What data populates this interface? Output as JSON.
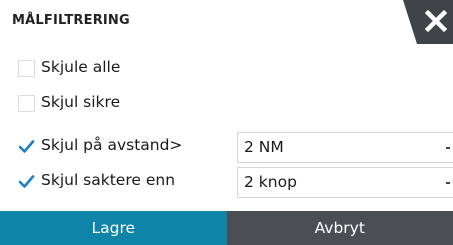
{
  "dialog": {
    "title": "MÅLFILTRERING",
    "close_icon": "close-icon"
  },
  "options": [
    {
      "label": "Skjule alle",
      "checked": false
    },
    {
      "label": "Skjul sikre",
      "checked": false
    },
    {
      "label": "Skjul på avstand>",
      "checked": true,
      "value": "2 NM"
    },
    {
      "label": "Skjul saktere enn",
      "checked": true,
      "value": "2 knop"
    }
  ],
  "footer": {
    "save_label": "Lagre",
    "cancel_label": "Avbryt"
  },
  "colors": {
    "accent": "#0e85a8",
    "cancel_bg": "#4b4f53",
    "check": "#1f7fc4"
  }
}
